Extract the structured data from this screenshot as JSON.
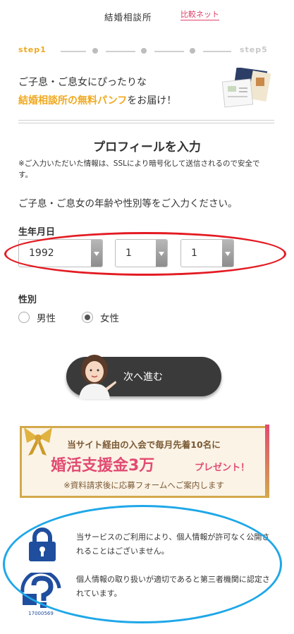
{
  "header": {
    "logo_main": "結婚相談所",
    "logo_sub": "比較ネット"
  },
  "steps": {
    "first": "step1",
    "last": "step5",
    "current": 1,
    "total": 5
  },
  "intro": {
    "line1": "ご子息・ご息女にぴったりな",
    "line2_highlight": "結婚相談所の無料パンフ",
    "line2_rest": "をお届け！"
  },
  "profile": {
    "title": "プロフィールを入力",
    "ssl_note": "※ご入力いただいた情報は、SSLにより暗号化して送信されるので安全です。",
    "instruction": "ご子息・ご息女の年齢や性別等をご入力ください。"
  },
  "birth": {
    "label": "生年月日",
    "year": "1992",
    "month": "1",
    "day": "1"
  },
  "gender": {
    "label": "性別",
    "male": "男性",
    "female": "女性",
    "selected": "female"
  },
  "next_button": {
    "label": "次へ進む"
  },
  "campaign": {
    "top": "当サイト経由の入会で毎月先着10名に",
    "main": "婚活支援金3万",
    "present": "プレゼント！",
    "note": "※資料請求後に応募フォームへご案内します"
  },
  "privacy": {
    "text1_line1": "当サービスのご利用により、個人情報が許可なく公開さ",
    "text1_line2": "れることはございません。",
    "text2_line1": "個人情報の取り扱いが適切であると第三者機関に認定さ",
    "text2_line2": "れています。",
    "pmark_number": "17000569"
  },
  "colors": {
    "accent_orange": "#f0a91f",
    "pink": "#e24a72",
    "red_annotation": "#e31b23",
    "blue_annotation": "#1ea7e8",
    "lock_blue": "#1f4e9e"
  }
}
